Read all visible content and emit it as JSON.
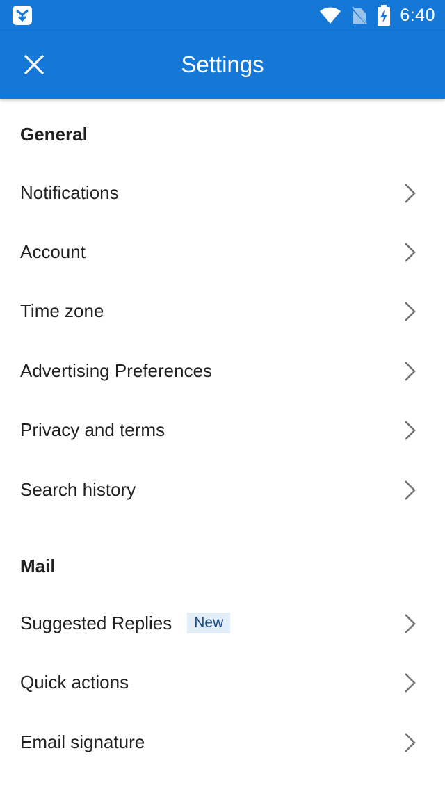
{
  "status_bar": {
    "time": "6:40",
    "icons": [
      "outlook-notification-icon",
      "wifi-icon",
      "no-sim-icon",
      "battery-charging-icon"
    ]
  },
  "app_bar": {
    "title": "Settings",
    "close_icon": "close-icon"
  },
  "colors": {
    "app_bar": "#1577d6",
    "badge_bg": "#e3edf8",
    "badge_text": "#1a4f8a",
    "chevron": "#757575"
  },
  "sections": {
    "general": {
      "header": "General",
      "items": [
        {
          "label": "Notifications"
        },
        {
          "label": "Account"
        },
        {
          "label": "Time zone"
        },
        {
          "label": "Advertising Preferences"
        },
        {
          "label": "Privacy and terms"
        },
        {
          "label": "Search history"
        }
      ]
    },
    "mail": {
      "header": "Mail",
      "items": [
        {
          "label": "Suggested Replies",
          "badge": "New"
        },
        {
          "label": "Quick actions"
        },
        {
          "label": "Email signature"
        }
      ]
    }
  }
}
